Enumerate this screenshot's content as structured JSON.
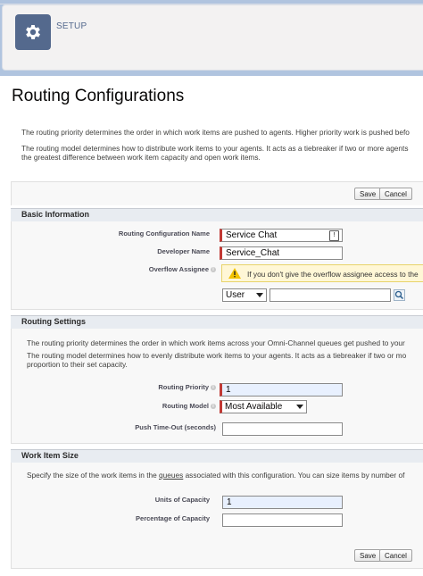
{
  "header": {
    "setup_label": "SETUP",
    "icon": "gear-icon"
  },
  "page": {
    "title": "Routing Configurations",
    "desc_priority": "The routing priority determines the order in which work items are pushed to agents. Higher priority work is pushed befo",
    "desc_model_1": "The routing model determines how to distribute work items to your agents. It acts as a tiebreaker if two or more agents",
    "desc_model_2": "the greatest difference between work item capacity and open work items."
  },
  "buttons": {
    "save": "Save",
    "cancel": "Cancel"
  },
  "basic_info": {
    "title": "Basic Information",
    "routing_config_name_label": "Routing Configuration Name",
    "routing_config_name_value": "Service Chat",
    "developer_name_label": "Developer Name",
    "developer_name_value": "Service_Chat",
    "overflow_assignee_label": "Overflow Assignee",
    "overflow_warning": "If you don't give the overflow assignee access to the",
    "assignee_type_selected": "User",
    "assignee_value": ""
  },
  "routing_settings": {
    "title": "Routing Settings",
    "desc_priority": "The routing priority determines the order in which work items across your Omni-Channel queues get pushed to your",
    "desc_model_1": "The routing model determines how to evenly distribute work items to your agents. It acts as a tiebreaker if two or mo",
    "desc_model_2": "proportion to their set capacity.",
    "routing_priority_label": "Routing Priority",
    "routing_priority_value": "1",
    "routing_model_label": "Routing Model",
    "routing_model_selected": "Most Available",
    "push_timeout_label": "Push Time-Out (seconds)",
    "push_timeout_value": ""
  },
  "work_item_size": {
    "title": "Work Item Size",
    "desc_before": "Specify the size of the work items in the ",
    "desc_link": "queues",
    "desc_after": " associated with this configuration. You can size items by number of",
    "units_label": "Units of Capacity",
    "units_value": "1",
    "percentage_label": "Percentage of Capacity",
    "percentage_value": ""
  },
  "colors": {
    "required_bar": "#c23934",
    "header_tile": "#54698d",
    "warning_bg": "#fff7d6",
    "warning_icon": "#f2c200"
  }
}
